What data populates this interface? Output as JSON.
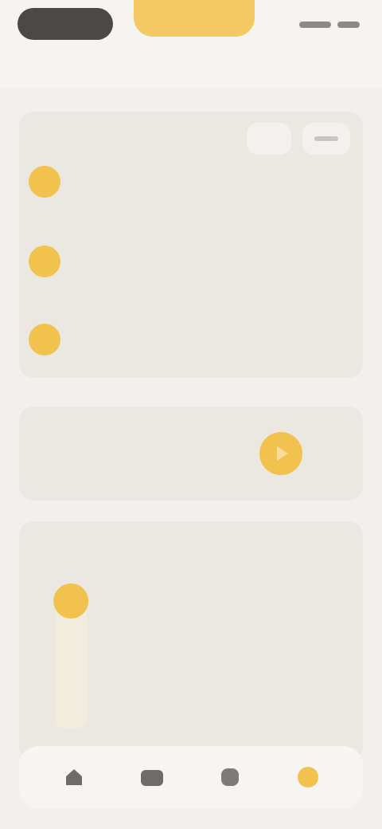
{
  "topbar": {
    "subtitle": ""
  },
  "list_card": {
    "title": "",
    "rows": [
      {
        "label": ""
      },
      {
        "label": ""
      },
      {
        "label": ""
      }
    ]
  },
  "timer_card": {
    "label": "",
    "value": "",
    "sub": ""
  },
  "chart_card": {
    "title": ""
  },
  "chart_data": {
    "type": "bar",
    "categories": [
      "",
      "",
      "",
      "",
      "",
      "",
      ""
    ],
    "values": [
      1,
      0,
      0,
      0,
      0,
      0,
      0
    ],
    "ylim": [
      0,
      1
    ],
    "grid": false
  },
  "bottom_nav": {
    "items": [
      {
        "icon": "home-icon",
        "active": false
      },
      {
        "icon": "calendar-icon",
        "active": false
      },
      {
        "icon": "stats-icon",
        "active": false
      },
      {
        "icon": "profile-icon",
        "active": true
      }
    ]
  },
  "colors": {
    "accent": "#f2c24f",
    "dark_pill": "#4a4946",
    "card_bg": "#ebe8e2",
    "page_bg": "#f1f0ec",
    "nav_icon": "#6e6c68"
  }
}
